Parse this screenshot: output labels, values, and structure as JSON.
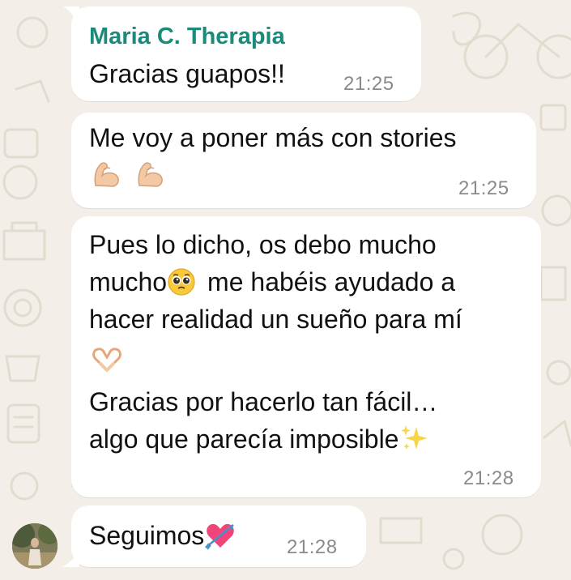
{
  "chat": {
    "messages": [
      {
        "sender": "Maria C. Therapia",
        "lines": [
          "Gracias guapos!!"
        ],
        "time": "21:25"
      },
      {
        "lines": [
          "Me voy a poner más con stories"
        ],
        "emoji_line": [
          "flexed-biceps-emoji",
          "flexed-biceps-emoji"
        ],
        "time": "21:25"
      },
      {
        "lines": [
          "Pues lo dicho, os debo mucho",
          "mucho",
          "me habéis ayudado a",
          "hacer realidad un sueño para mí",
          "Gracias por hacerlo tan fácil…",
          "algo que parecía imposible"
        ],
        "emojis": [
          "pleading-face-emoji",
          "heart-hands-emoji",
          "sparkles-emoji"
        ],
        "time": "21:28"
      },
      {
        "lines": [
          "Seguimos"
        ],
        "emojis": [
          "heart-with-arrow-emoji"
        ],
        "time": "21:28"
      }
    ]
  },
  "colors": {
    "background": "#f3efe8",
    "bubble": "#ffffff",
    "sender_name": "#1a8a7a",
    "timestamp": "#8a8a8a"
  }
}
